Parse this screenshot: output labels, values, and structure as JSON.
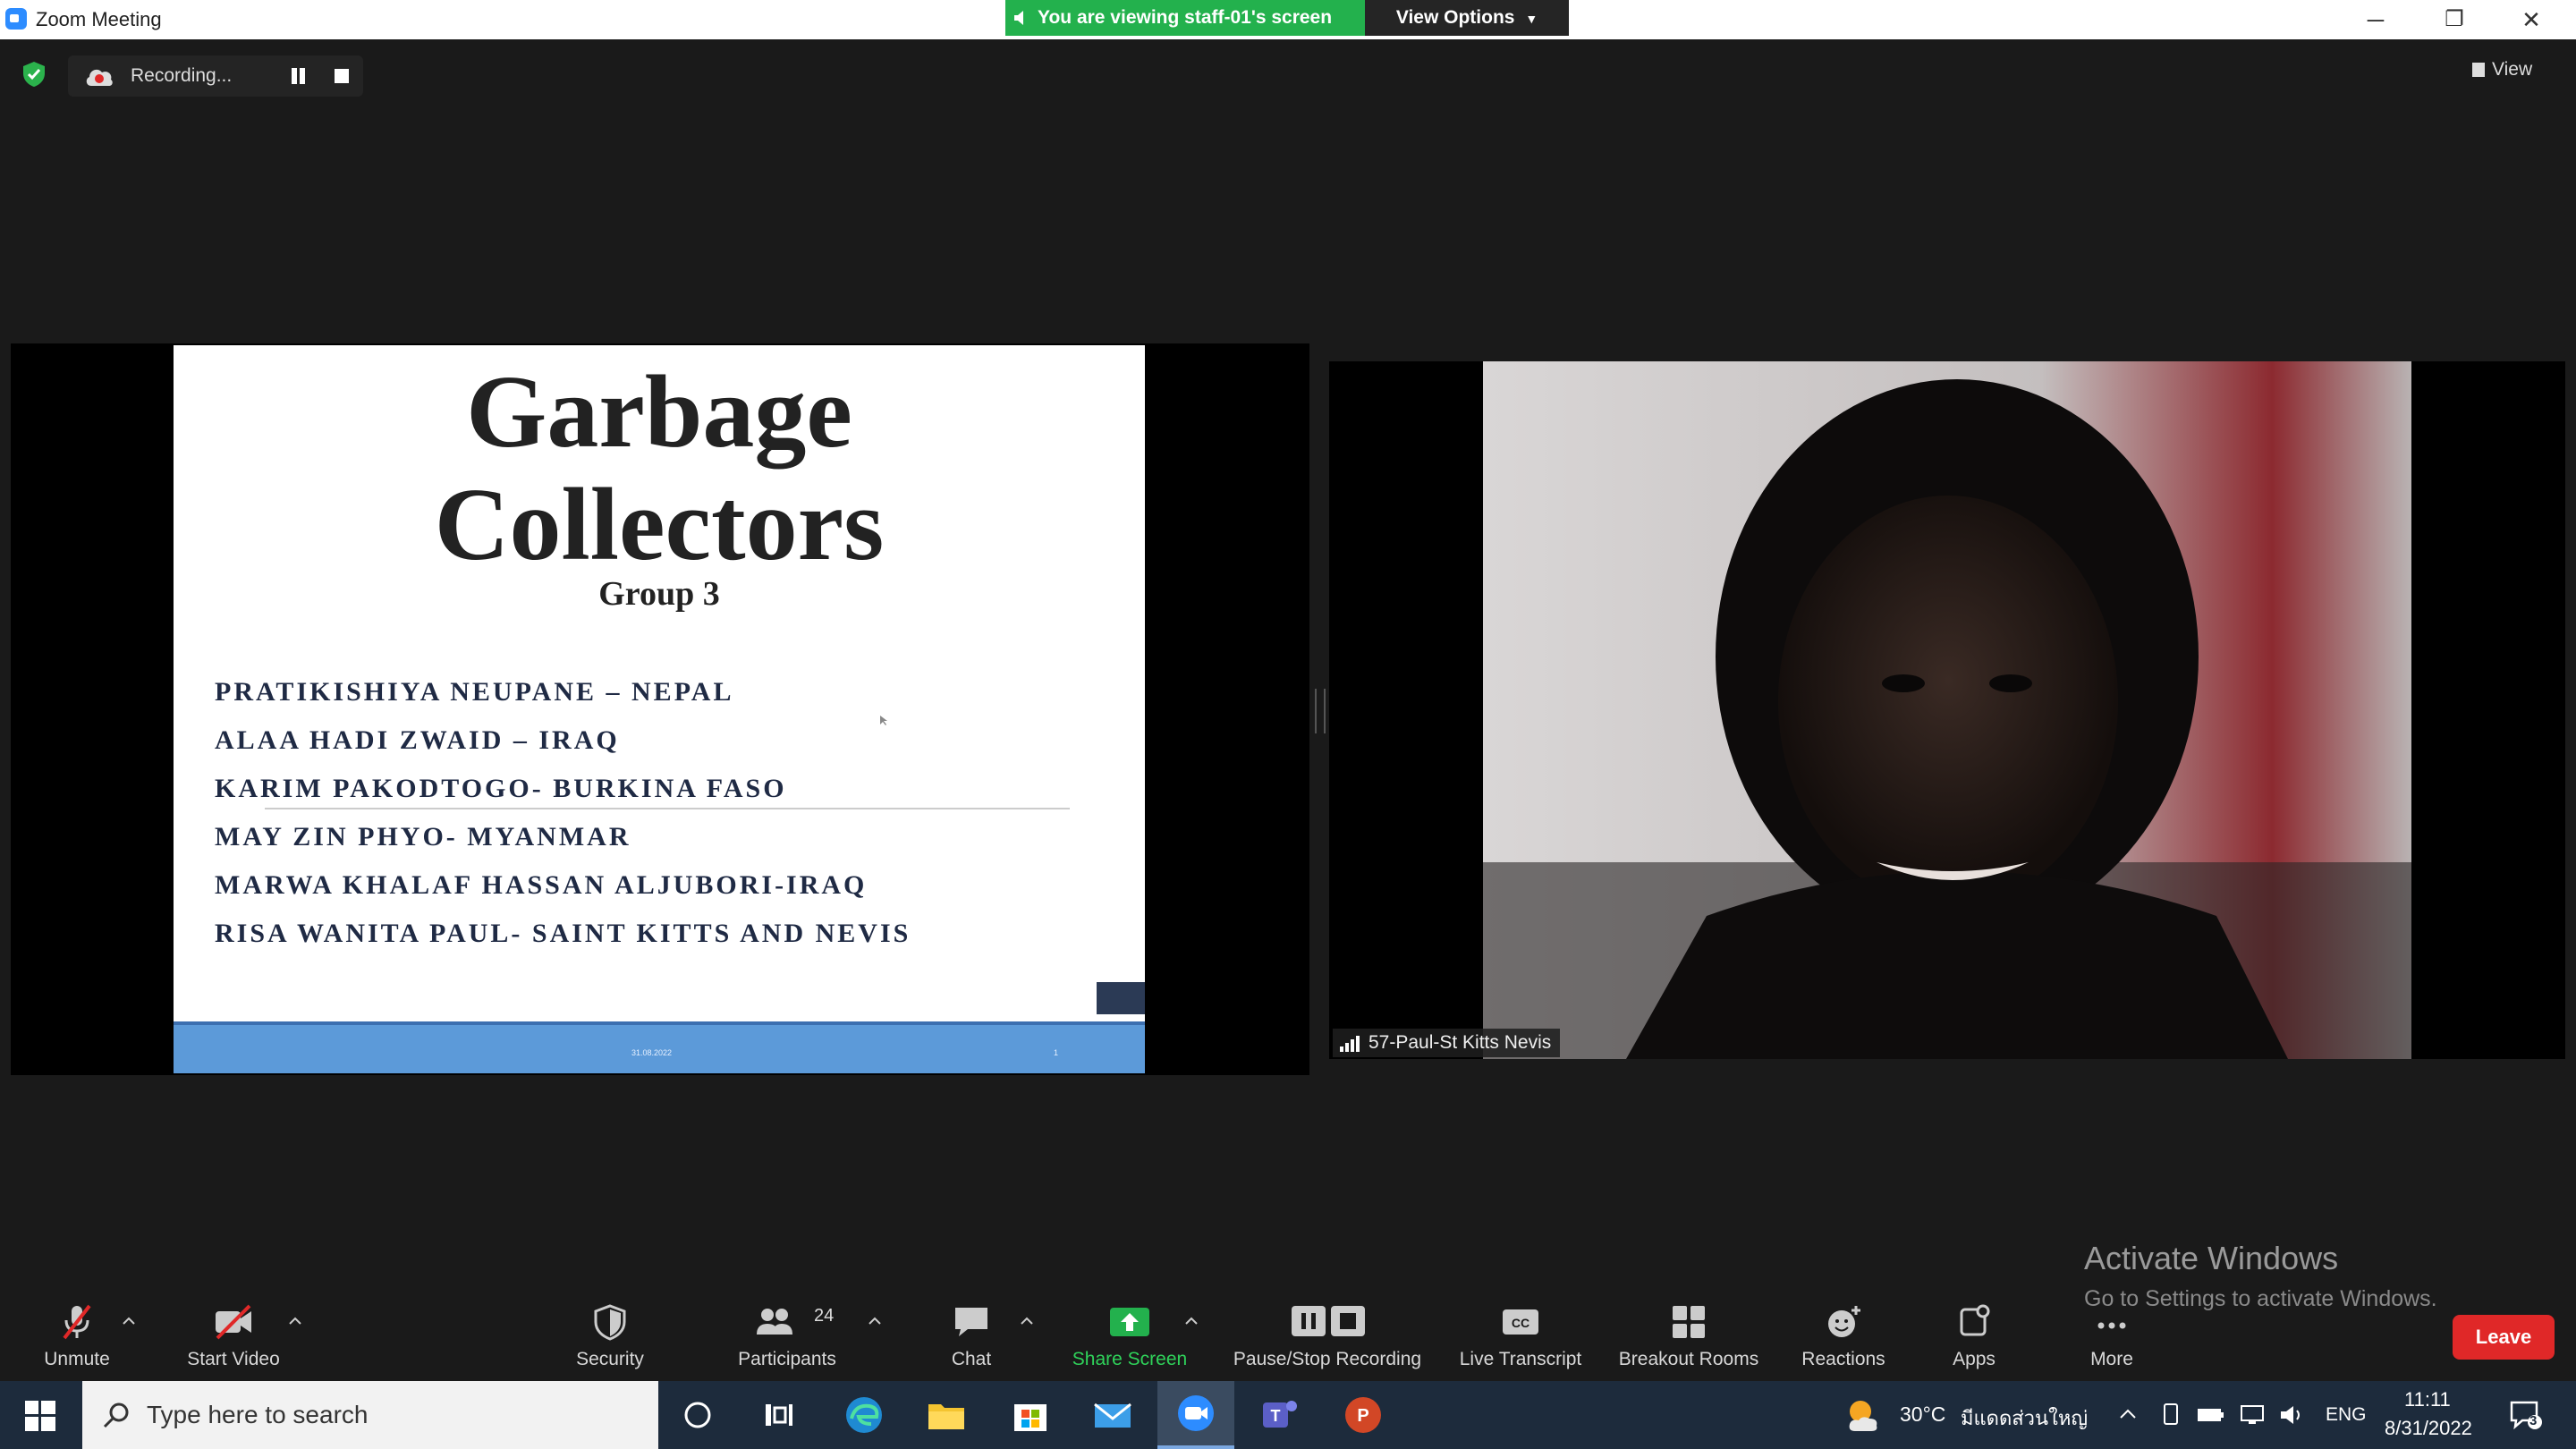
{
  "window": {
    "title": "Zoom Meeting",
    "share_banner": "You are viewing staff-01's screen",
    "view_options": "View Options",
    "minimize": "─",
    "restore": "❐",
    "close": "✕"
  },
  "recording": {
    "label": "Recording..."
  },
  "top_right": {
    "view_label": "View"
  },
  "slide": {
    "title_line1": "Garbage",
    "title_line2": "Collectors",
    "subtitle": "Group 3",
    "members": [
      "PRATIKISHIYA NEUPANE – NEPAL",
      "ALAA HADI ZWAID – IRAQ",
      "KARIM PAKODTOGO- BURKINA FASO",
      "MAY ZIN PHYO- MYANMAR",
      "MARWA KHALAF HASSAN ALJUBORI-IRAQ",
      "RISA WANITA PAUL- SAINT KITTS AND NEVIS"
    ],
    "footer_date": "31.08.2022",
    "footer_page": "1"
  },
  "video": {
    "participant_name": "57-Paul-St Kitts Nevis"
  },
  "watermark": {
    "line1": "Activate Windows",
    "line2": "Go to Settings to activate Windows."
  },
  "toolbar": {
    "unmute": "Unmute",
    "start_video": "Start Video",
    "security": "Security",
    "participants": "Participants",
    "participants_count": "24",
    "chat": "Chat",
    "share_screen": "Share Screen",
    "pause_stop_recording": "Pause/Stop Recording",
    "live_transcript": "Live Transcript",
    "breakout_rooms": "Breakout Rooms",
    "reactions": "Reactions",
    "apps": "Apps",
    "more": "More",
    "leave": "Leave"
  },
  "taskbar": {
    "search_placeholder": "Type here to search",
    "weather": "30°C",
    "location": "มีแดดส่วนใหญ่",
    "language": "ENG",
    "time": "11:11",
    "date": "8/31/2022",
    "notification_count": "3"
  },
  "colors": {
    "share_green": "#23b14d",
    "leave_red": "#e02828",
    "slide_footer_blue": "#5c9ad9",
    "taskbar_bg": "#1d2b3c"
  }
}
